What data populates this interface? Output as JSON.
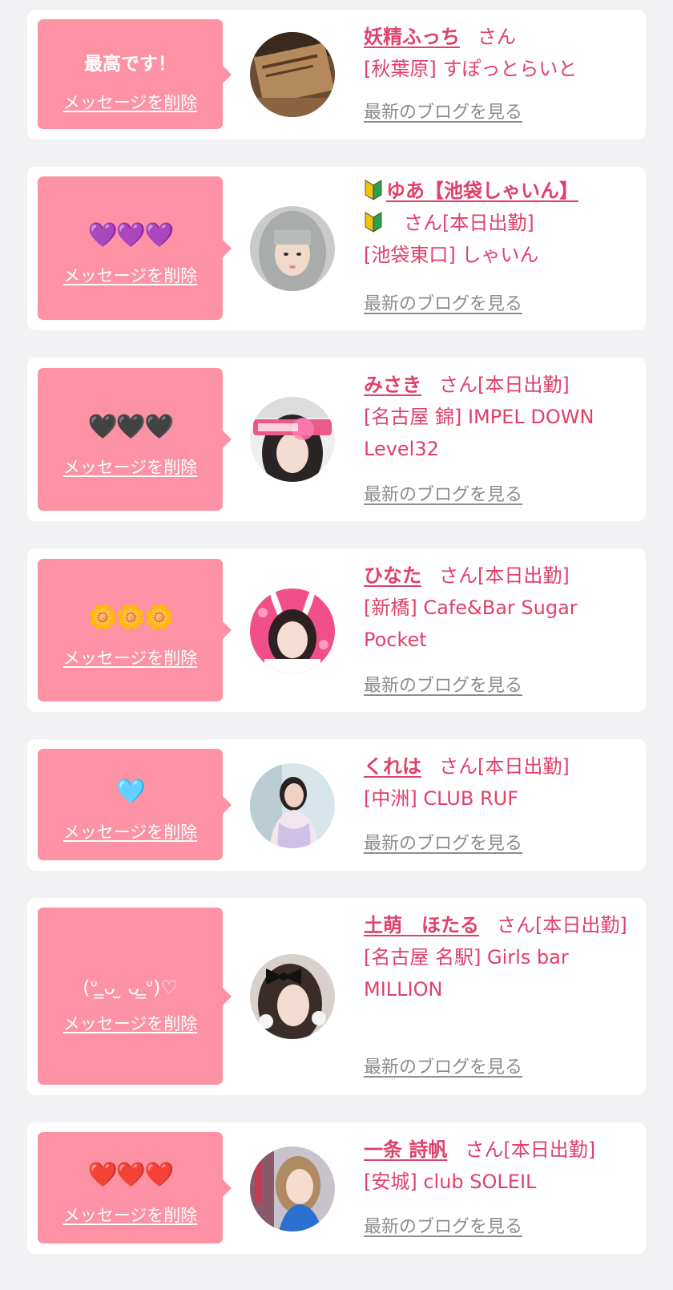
{
  "delete_label": "メッセージを削除",
  "blog_label": "最新のブログを見る",
  "san_label": "さん",
  "colors": {
    "page_background": "#f2f2f4",
    "card_background": "#ffffff",
    "bubble": "#fc92a3",
    "accent_text": "#e0406a",
    "blog_link": "#8c8c8c"
  },
  "items": [
    {
      "message": "最高です！",
      "name": "妖精ふっち",
      "status": "",
      "shop": "[秋葉原] すぽっとらいと",
      "avatar_icon": "wood-sign-photo-avatar"
    },
    {
      "message": "💜💜💜",
      "name": "ゆあ【池袋しゃいん】",
      "name_prefix_icon": "beginner-mark-icon",
      "status": "[本日出勤]",
      "shop": "[池袋東口] しゃいん",
      "avatar_icon": "silver-hair-girl-avatar"
    },
    {
      "message": "🖤🖤🖤",
      "name": "みさき",
      "status": "[本日出勤]",
      "shop": "[名古屋 錦] IMPEL DOWN Level32",
      "avatar_icon": "dark-hair-girl-avatar"
    },
    {
      "message": "🌼🌼🌼",
      "name": "ひなた",
      "status": "[本日出勤]",
      "shop": "[新橋] Cafe&Bar Sugar Pocket",
      "avatar_icon": "bunny-ears-girl-avatar"
    },
    {
      "message": "🩵",
      "name": "くれは",
      "status": "[本日出勤]",
      "shop": "[中洲] CLUB RUF",
      "avatar_icon": "outdoor-girl-avatar"
    },
    {
      "message": "(ᐡ ̳ᴗ ̫ ᴗ ̳ᐡ)♡",
      "name": "土萌　ほたる",
      "status": "[本日出勤]",
      "shop": "[名古屋 名駅] Girls bar MILLION",
      "avatar_icon": "black-bow-girl-avatar"
    },
    {
      "message": "❤️❤️❤️",
      "name": "一条 詩帆",
      "status": "[本日出勤]",
      "shop": "[安城] club SOLEIL",
      "avatar_icon": "blonde-girl-avatar"
    }
  ]
}
